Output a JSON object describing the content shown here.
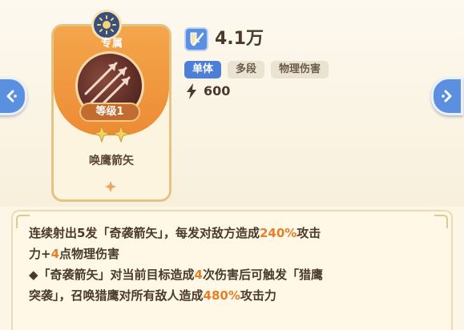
{
  "card": {
    "exclusive_label": "专属",
    "level_label": "等级1",
    "skill_name": "唤鹰箭矢",
    "stars": 2,
    "icons": [
      "sun-emblem-icon",
      "hawk-arrow-icon",
      "star-icon",
      "diamond-icon"
    ]
  },
  "stats": {
    "damage_value": "4.1万",
    "damage_icon": "sword-shield-icon",
    "tags": [
      "单体",
      "多段",
      "物理伤害"
    ],
    "energy_icon": "lightning-icon",
    "energy_value": "600"
  },
  "nav": {
    "prev_icon": "chevron-left-icon",
    "next_icon": "chevron-right-icon"
  },
  "description": {
    "line1_a": "连续射出5发「奇袭箭矢」，每发对敌方造成",
    "line1_hl": "240%",
    "line1_b": "攻击",
    "line2_a": "力+",
    "line2_hl": "4",
    "line2_b": "点物理伤害",
    "line3_a": "◆「奇袭箭矢」对当前目标造成",
    "line3_hl": "4",
    "line3_b": "次伤害后可触发「猎鹰",
    "line4_a": "突袭」，召唤猎鹰对所有敌人造成",
    "line4_hl": "480%",
    "line4_b": "攻击力"
  },
  "colors": {
    "accent_orange": "#ec8c35",
    "highlight": "#e57f2a",
    "nav_blue": "#5b8fe0",
    "tag_blue": "#4e7fd6"
  }
}
